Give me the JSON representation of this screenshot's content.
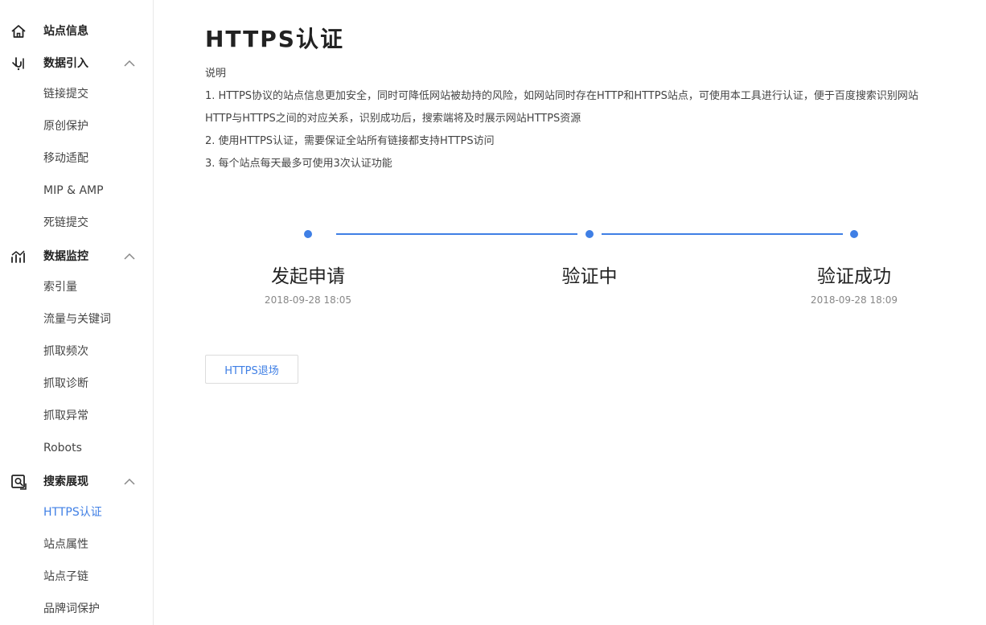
{
  "sidebar": {
    "site_info": {
      "label": "站点信息",
      "icon": "home-icon"
    },
    "groups": [
      {
        "label": "数据引入",
        "icon": "data-import-icon",
        "items": [
          "链接提交",
          "原创保护",
          "移动适配",
          "MIP & AMP",
          "死链提交"
        ]
      },
      {
        "label": "数据监控",
        "icon": "data-monitor-icon",
        "items": [
          "索引量",
          "流量与关键词",
          "抓取频次",
          "抓取诊断",
          "抓取异常",
          "Robots"
        ]
      },
      {
        "label": "搜索展现",
        "icon": "search-display-icon",
        "items": [
          "HTTPS认证",
          "站点属性",
          "站点子链",
          "品牌词保护"
        ]
      }
    ],
    "active_item": "HTTPS认证",
    "accent_color": "#3f7fe5"
  },
  "main": {
    "title": "HTTPS认证",
    "description": {
      "heading": "说明",
      "lines": [
        "1. HTTPS协议的站点信息更加安全，同时可降低网站被劫持的风险，如网站同时存在HTTP和HTTPS站点，可使用本工具进行认证，便于百度搜索识别网站",
        "HTTP与HTTPS之间的对应关系，识别成功后，搜索端将及时展示网站HTTPS资源",
        "2. 使用HTTPS认证，需要保证全站所有链接都支持HTTPS访问",
        "3. 每个站点每天最多可使用3次认证功能"
      ]
    },
    "steps": [
      {
        "label": "发起申请",
        "time": "2018-09-28 18:05"
      },
      {
        "label": "验证中",
        "time": ""
      },
      {
        "label": "验证成功",
        "time": "2018-09-28 18:09"
      }
    ],
    "exit_button": "HTTPS退场"
  }
}
